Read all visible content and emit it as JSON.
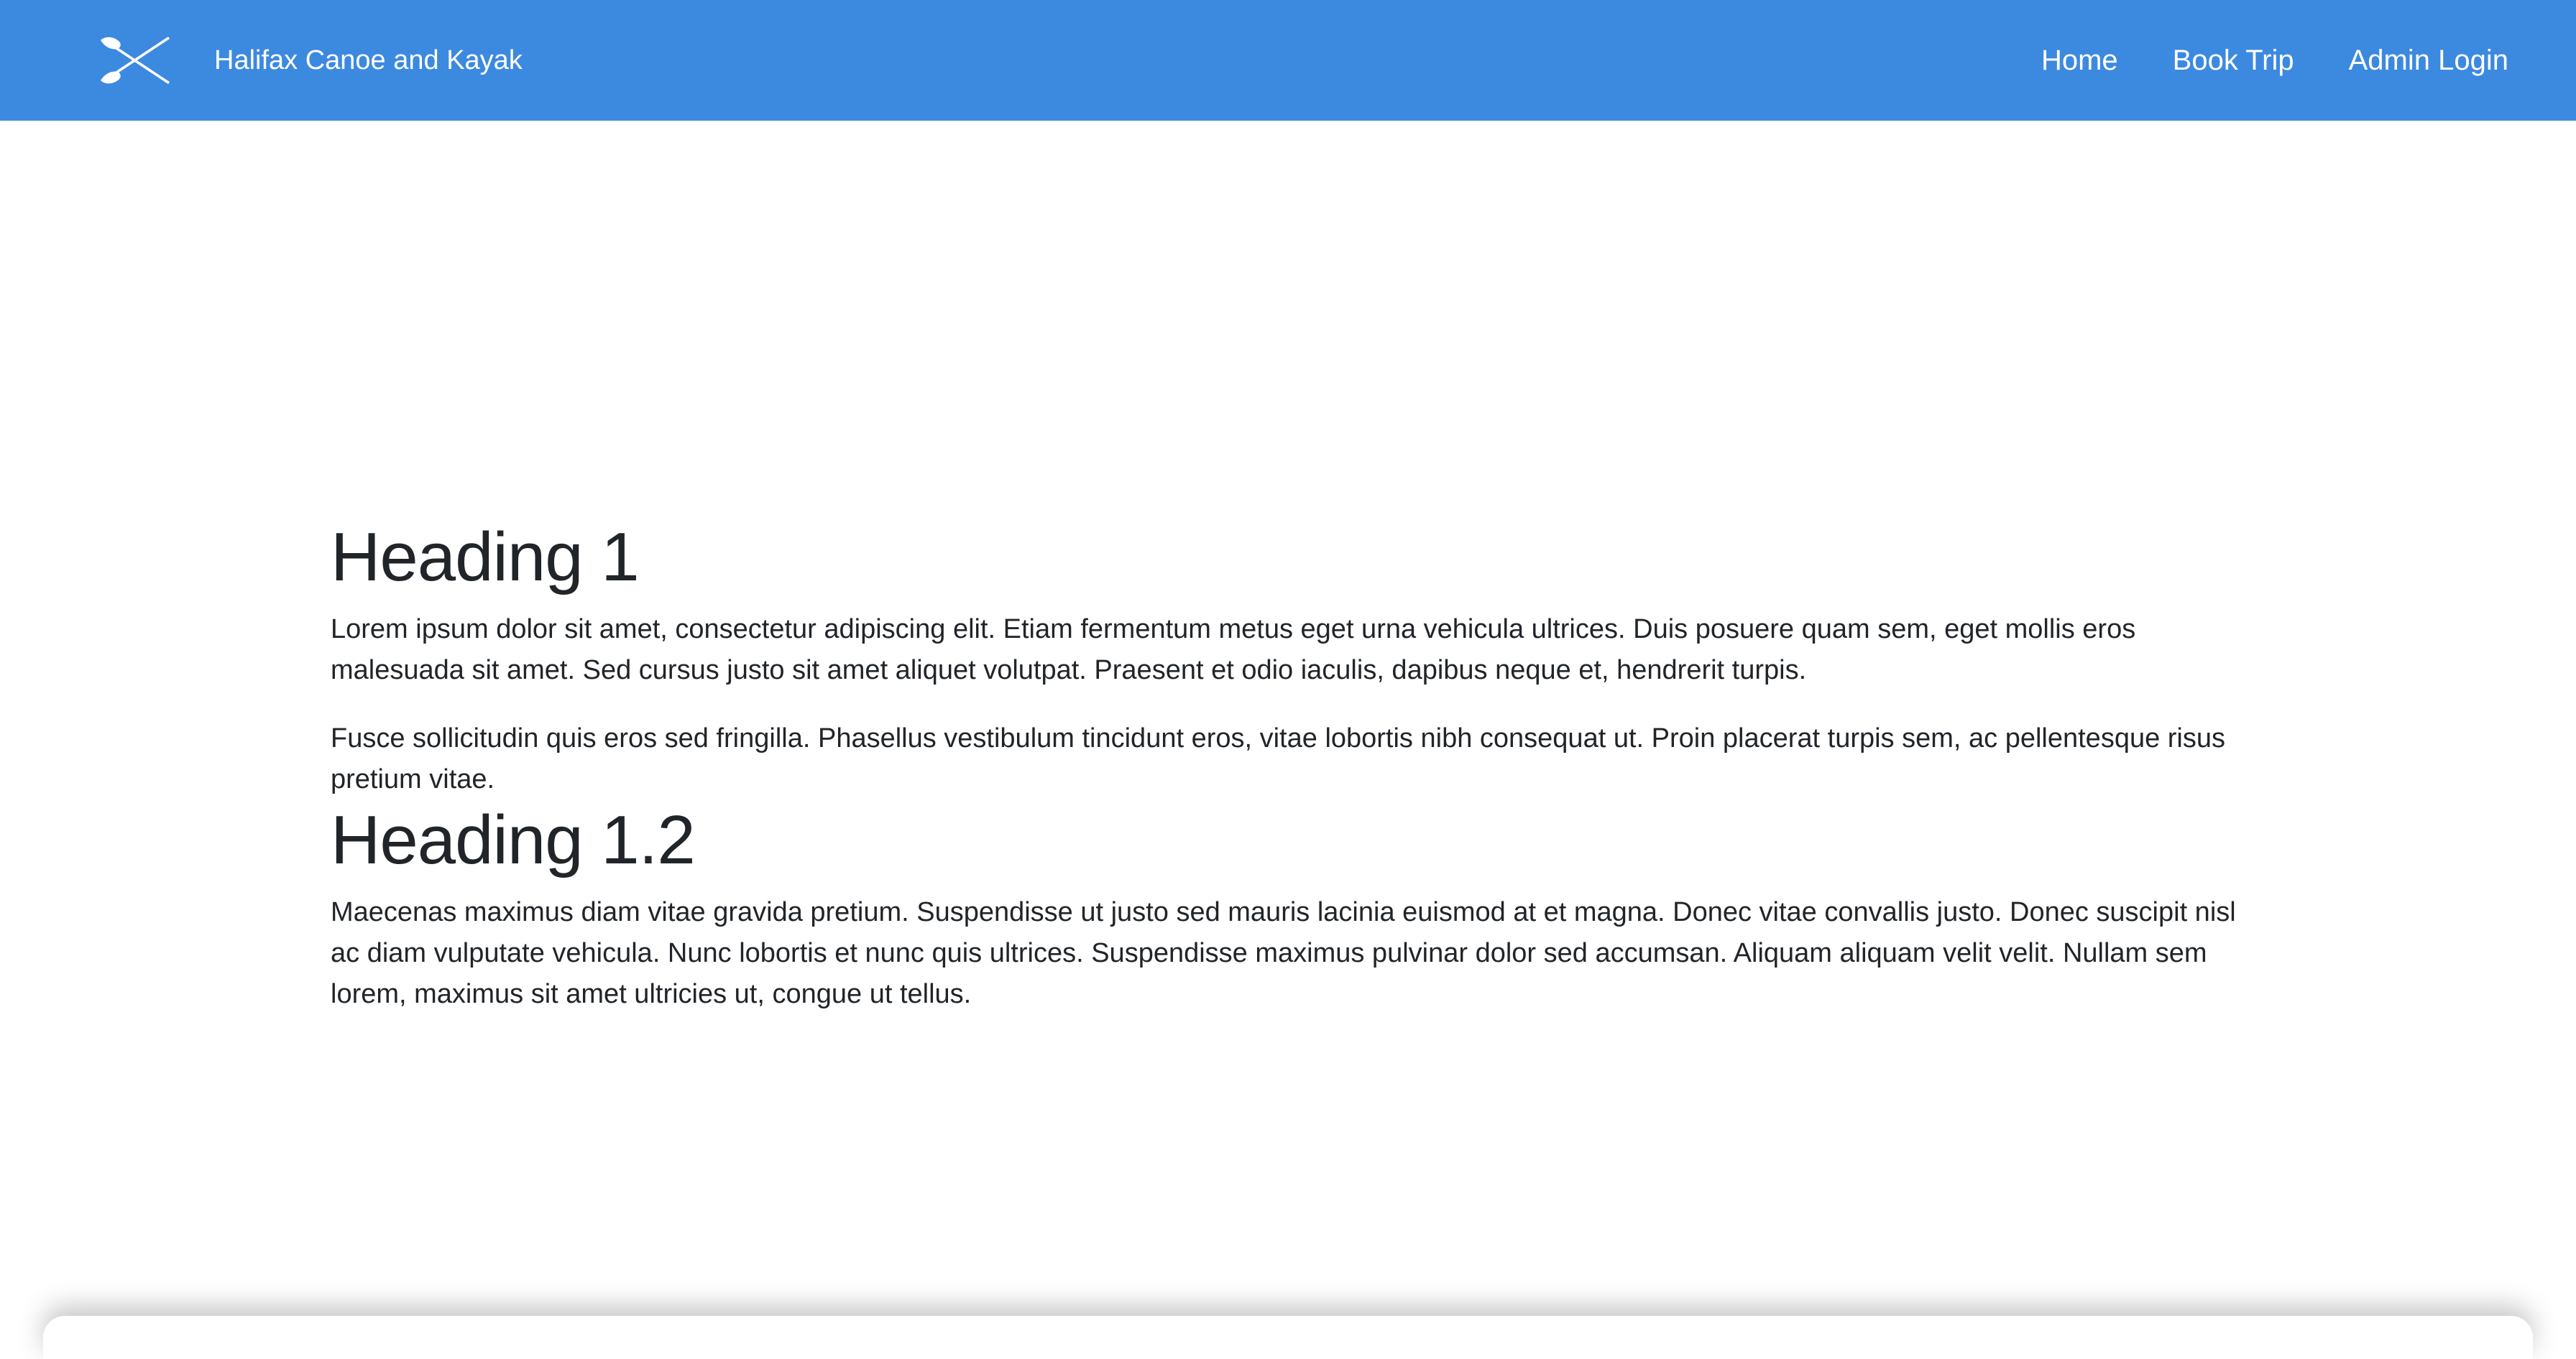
{
  "navbar": {
    "brand_name": "Halifax Canoe and Kayak",
    "logo_icon": "crossed-paddles-icon",
    "background_color": "#3c89e0",
    "links": [
      {
        "label": "Home"
      },
      {
        "label": "Book Trip"
      },
      {
        "label": "Admin Login"
      }
    ]
  },
  "main": {
    "sections": [
      {
        "heading": "Heading 1",
        "paragraphs": [
          "Lorem ipsum dolor sit amet, consectetur adipiscing elit. Etiam fermentum metus eget urna vehicula ultrices. Duis posuere quam sem, eget mollis eros malesuada sit amet. Sed cursus justo sit amet aliquet volutpat. Praesent et odio iaculis, dapibus neque et, hendrerit turpis.",
          "Fusce sollicitudin quis eros sed fringilla. Phasellus vestibulum tincidunt eros, vitae lobortis nibh consequat ut. Proin placerat turpis sem, ac pellentesque risus pretium vitae."
        ]
      },
      {
        "heading": "Heading 1.2",
        "paragraphs": [
          "Maecenas maximus diam vitae gravida pretium. Suspendisse ut justo sed mauris lacinia euismod at et magna. Donec vitae convallis justo. Donec suscipit nisl ac diam vulputate vehicula. Nunc lobortis et nunc quis ultrices. Suspendisse maximus pulvinar dolor sed accumsan. Aliquam aliquam velit velit. Nullam sem lorem, maximus sit amet ultricies ut, congue ut tellus."
        ]
      }
    ]
  }
}
